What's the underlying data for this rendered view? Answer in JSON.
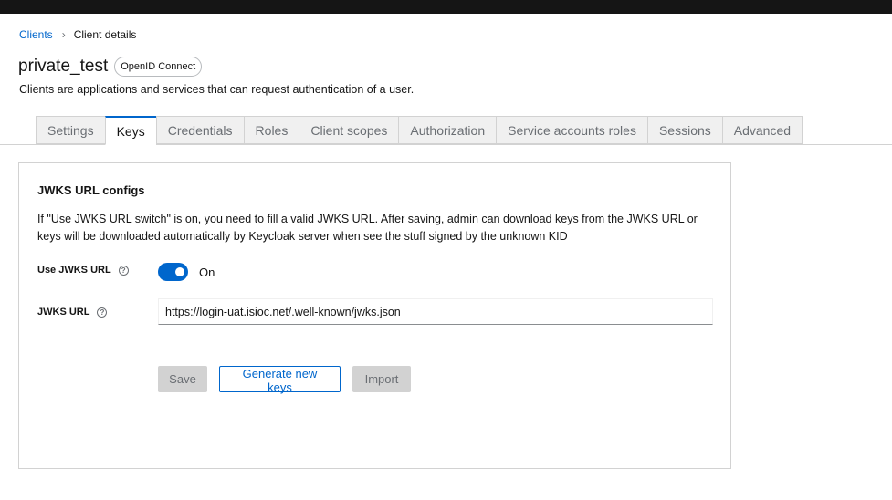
{
  "breadcrumb": {
    "parent": "Clients",
    "separator": "›",
    "current": "Client details"
  },
  "header": {
    "title": "private_test",
    "protocol_badge": "OpenID Connect",
    "subtitle": "Clients are applications and services that can request authentication of a user."
  },
  "tabs": [
    {
      "label": "Settings",
      "active": false
    },
    {
      "label": "Keys",
      "active": true
    },
    {
      "label": "Credentials",
      "active": false
    },
    {
      "label": "Roles",
      "active": false
    },
    {
      "label": "Client scopes",
      "active": false
    },
    {
      "label": "Authorization",
      "active": false
    },
    {
      "label": "Service accounts roles",
      "active": false
    },
    {
      "label": "Sessions",
      "active": false
    },
    {
      "label": "Advanced",
      "active": false
    }
  ],
  "jwks": {
    "title": "JWKS URL configs",
    "description": "If \"Use JWKS URL switch\" is on, you need to fill a valid JWKS URL. After saving, admin can download keys from the JWKS URL or keys will be downloaded automatically by Keycloak server when see the stuff signed by the unknown KID",
    "use_label": "Use JWKS URL",
    "use_enabled": true,
    "use_state_label": "On",
    "url_label": "JWKS URL",
    "url_value": "https://login-uat.isioc.net/.well-known/jwks.json",
    "help_glyph": "?"
  },
  "actions": {
    "save": "Save",
    "generate": "Generate new keys",
    "import": "Import"
  },
  "colors": {
    "accent": "#0066cc",
    "topbar": "#151515",
    "disabled": "#d2d2d2"
  }
}
